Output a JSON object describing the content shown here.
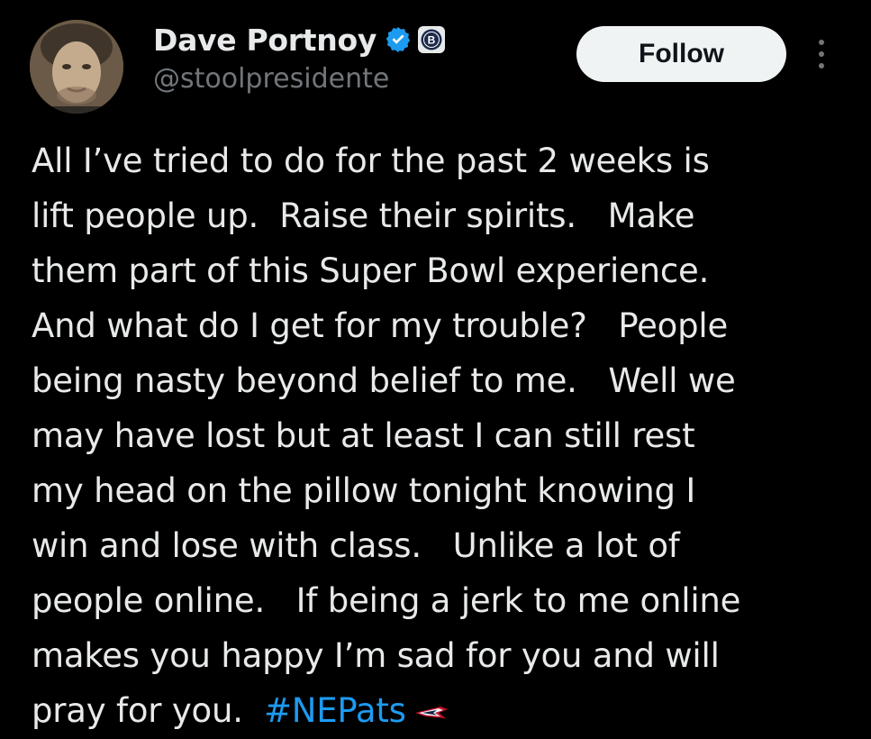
{
  "author": {
    "display_name": "Dave Portnoy",
    "handle": "@stoolpresidente",
    "verified_icon": "verified-badge-icon",
    "affiliation_icon": "barstool-logo-icon",
    "verified_color": "#1d9bf0"
  },
  "actions": {
    "follow_label": "Follow",
    "more_icon": "more-options-icon"
  },
  "tweet": {
    "text": "All I’ve tried to do for the past 2 weeks is\nlift people up.  Raise their spirits.   Make\nthem part of this Super Bowl experience.\nAnd what do I get for my trouble?   People\nbeing nasty beyond belief to me.   Well we\nmay have lost but at least I can still rest\nmy head on the pillow tonight knowing I\nwin and lose with class.   Unlike a lot of\npeople online.   If being a jerk to me online\nmakes you happy I’m sad for you and will\npray for you.  ",
    "hashtag": "#NEPats",
    "hashtag_emoji_icon": "patriots-logo-icon",
    "hashtag_color": "#1d9bf0"
  }
}
